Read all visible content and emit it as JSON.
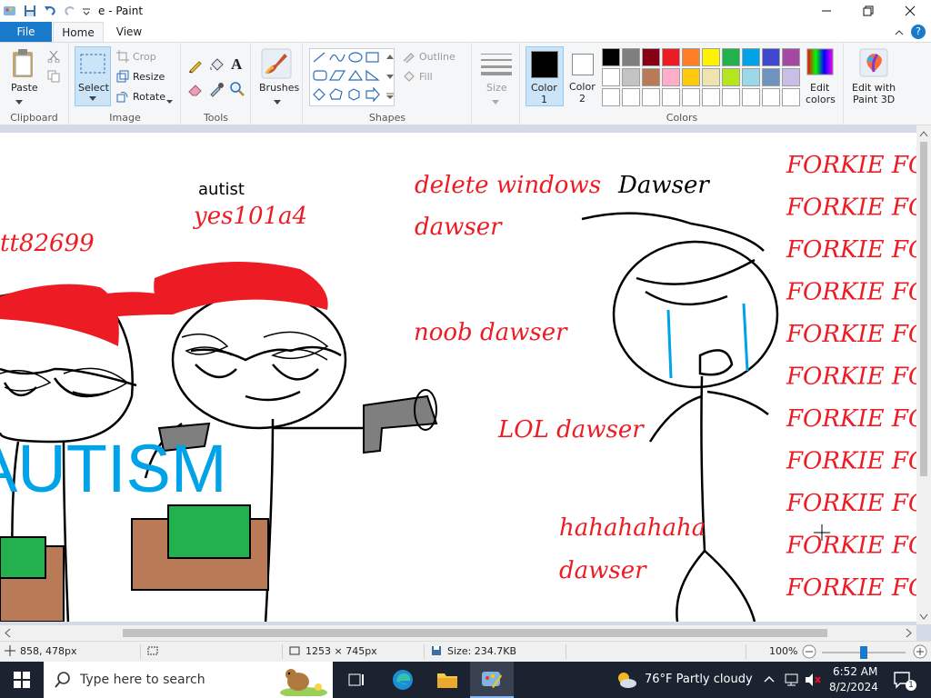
{
  "window": {
    "title": "e - Paint"
  },
  "menu": {
    "file": "File",
    "home": "Home",
    "view": "View"
  },
  "ribbon": {
    "clipboard": {
      "paste": "Paste",
      "group": "Clipboard"
    },
    "image": {
      "select": "Select",
      "crop": "Crop",
      "resize": "Resize",
      "rotate": "Rotate",
      "group": "Image"
    },
    "tools": {
      "group": "Tools"
    },
    "brushes": {
      "label": "Brushes"
    },
    "shapes": {
      "outline": "Outline",
      "fill": "Fill",
      "group": "Shapes"
    },
    "size": {
      "label": "Size"
    },
    "colors": {
      "color1": "Color\n1",
      "color1_line1": "Color",
      "color1_line2": "1",
      "color2_line1": "Color",
      "color2_line2": "2",
      "edit_line1": "Edit",
      "edit_line2": "colors",
      "paint3d_line1": "Edit with",
      "paint3d_line2": "Paint 3D",
      "group": "Colors",
      "palette_row1": [
        "#000000",
        "#7f7f7f",
        "#880015",
        "#ed1c24",
        "#ff7f27",
        "#fff200",
        "#22b14c",
        "#00a2e8",
        "#3f48cc",
        "#a349a4"
      ],
      "palette_row2": [
        "#ffffff",
        "#c3c3c3",
        "#b97a57",
        "#ffaec9",
        "#ffc90e",
        "#efe4b0",
        "#b5e61d",
        "#99d9ea",
        "#7092be",
        "#c8bfe7"
      ]
    }
  },
  "drawing": {
    "autist": "autist",
    "yes": "yes101a4",
    "tt": "tt82699",
    "delete_windows": "delete windows",
    "dawser_title": "Dawser",
    "dawser1": "dawser",
    "noob": "noob dawser",
    "lol": "LOL dawser",
    "haha": "hahahahaha",
    "dawser2": "dawser",
    "autism": "AUTISM",
    "forkie": "FORKIE FO"
  },
  "status": {
    "cursor": "858, 478px",
    "dimensions": "1253 × 745px",
    "size": "Size: 234.7KB",
    "zoom": "100%"
  },
  "taskbar": {
    "search_placeholder": "Type here to search",
    "weather": "76°F  Partly cloudy",
    "time": "6:52 AM",
    "date": "8/2/2024",
    "notif_count": "1"
  }
}
